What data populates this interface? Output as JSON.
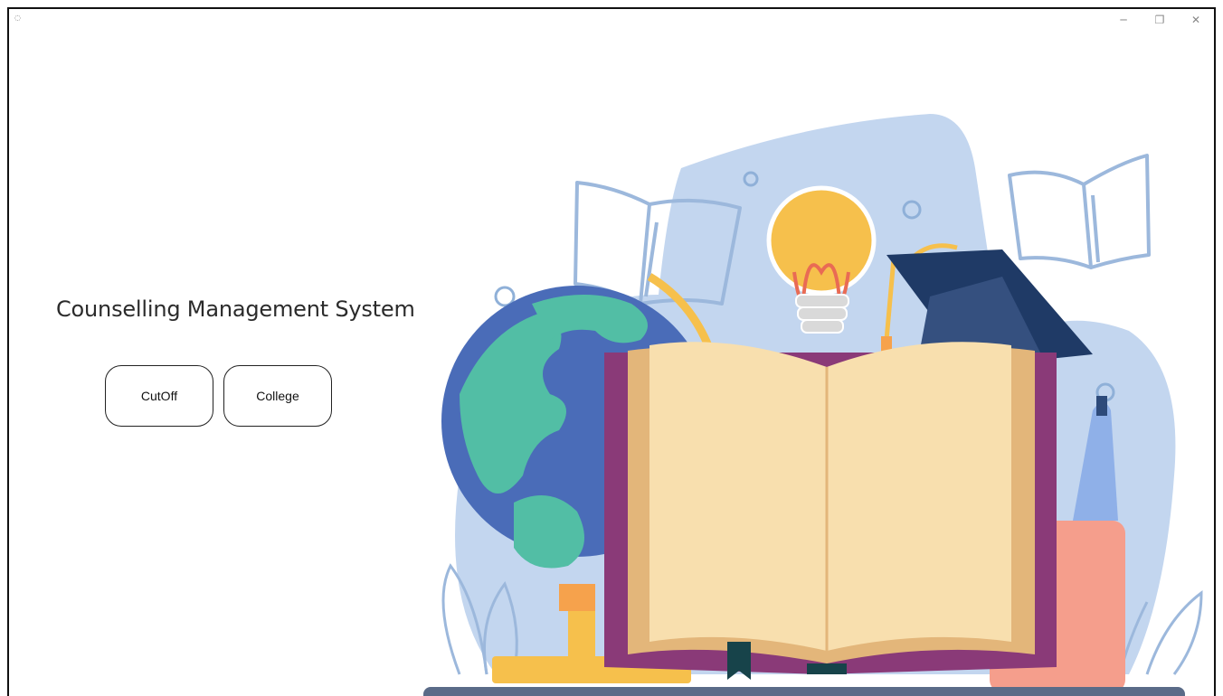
{
  "window": {
    "controls": {
      "minimize": "─",
      "maximize": "❐",
      "close": "✕"
    }
  },
  "main": {
    "title": "Counselling Management System",
    "buttons": {
      "cutoff": "CutOff",
      "college": "College"
    }
  },
  "colors": {
    "background_blob": "#c3d6ef",
    "globe_ocean": "#4a6cb8",
    "globe_land": "#52bea5",
    "book_cover": "#8a3a78",
    "book_pages": "#f8dfae",
    "cap": "#2d4a7a",
    "bulb": "#f6c04c",
    "desk": "#5a6b88"
  },
  "icons": [
    "app-icon",
    "minimize-icon",
    "maximize-icon",
    "close-icon"
  ]
}
